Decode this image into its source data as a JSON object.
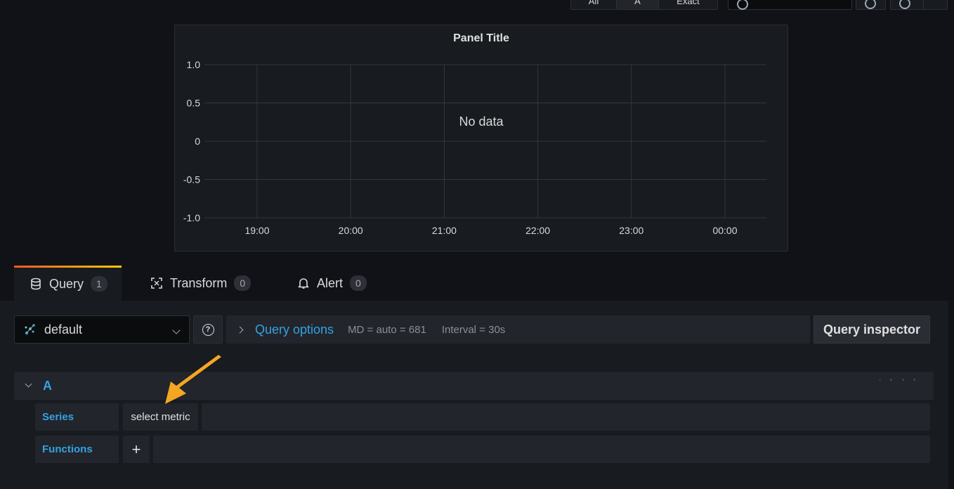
{
  "toolbar": {
    "time_range_buttons": [
      "All",
      "A",
      "Exact"
    ],
    "active_index": 1
  },
  "panel": {
    "title": "Panel Title",
    "no_data_text": "No data"
  },
  "chart_data": {
    "type": "line",
    "series": [],
    "x": [
      "19:00",
      "20:00",
      "21:00",
      "22:00",
      "23:00",
      "00:00"
    ],
    "y_ticks": [
      "1.0",
      "0.5",
      "0",
      "-0.5",
      "-1.0"
    ],
    "ylim": [
      -1.0,
      1.0
    ],
    "grid": true,
    "annotations": [
      "No data"
    ]
  },
  "tabs": [
    {
      "label": "Query",
      "count": "1",
      "icon": "database-icon"
    },
    {
      "label": "Transform",
      "count": "0",
      "icon": "transform-icon"
    },
    {
      "label": "Alert",
      "count": "0",
      "icon": "bell-icon"
    }
  ],
  "datasource": {
    "name": "default",
    "icon": "graphite-logo-icon"
  },
  "query_options": {
    "title": "Query options",
    "md": "MD = auto = 681",
    "interval": "Interval = 30s"
  },
  "query_inspector_label": "Query inspector",
  "query_row": {
    "ref_id": "A",
    "actions": [
      "edit-icon",
      "duplicate-icon",
      "eye-icon",
      "trash-icon",
      "drag-handle-icon"
    ],
    "series_label": "Series",
    "series_value": "select metric",
    "functions_label": "Functions",
    "add_function": "+"
  },
  "colors": {
    "accent_blue": "#33a2e5",
    "annotation_arrow": "#f5a623",
    "tab_gradient_start": "#f05a28",
    "tab_gradient_end": "#fbca0a"
  }
}
